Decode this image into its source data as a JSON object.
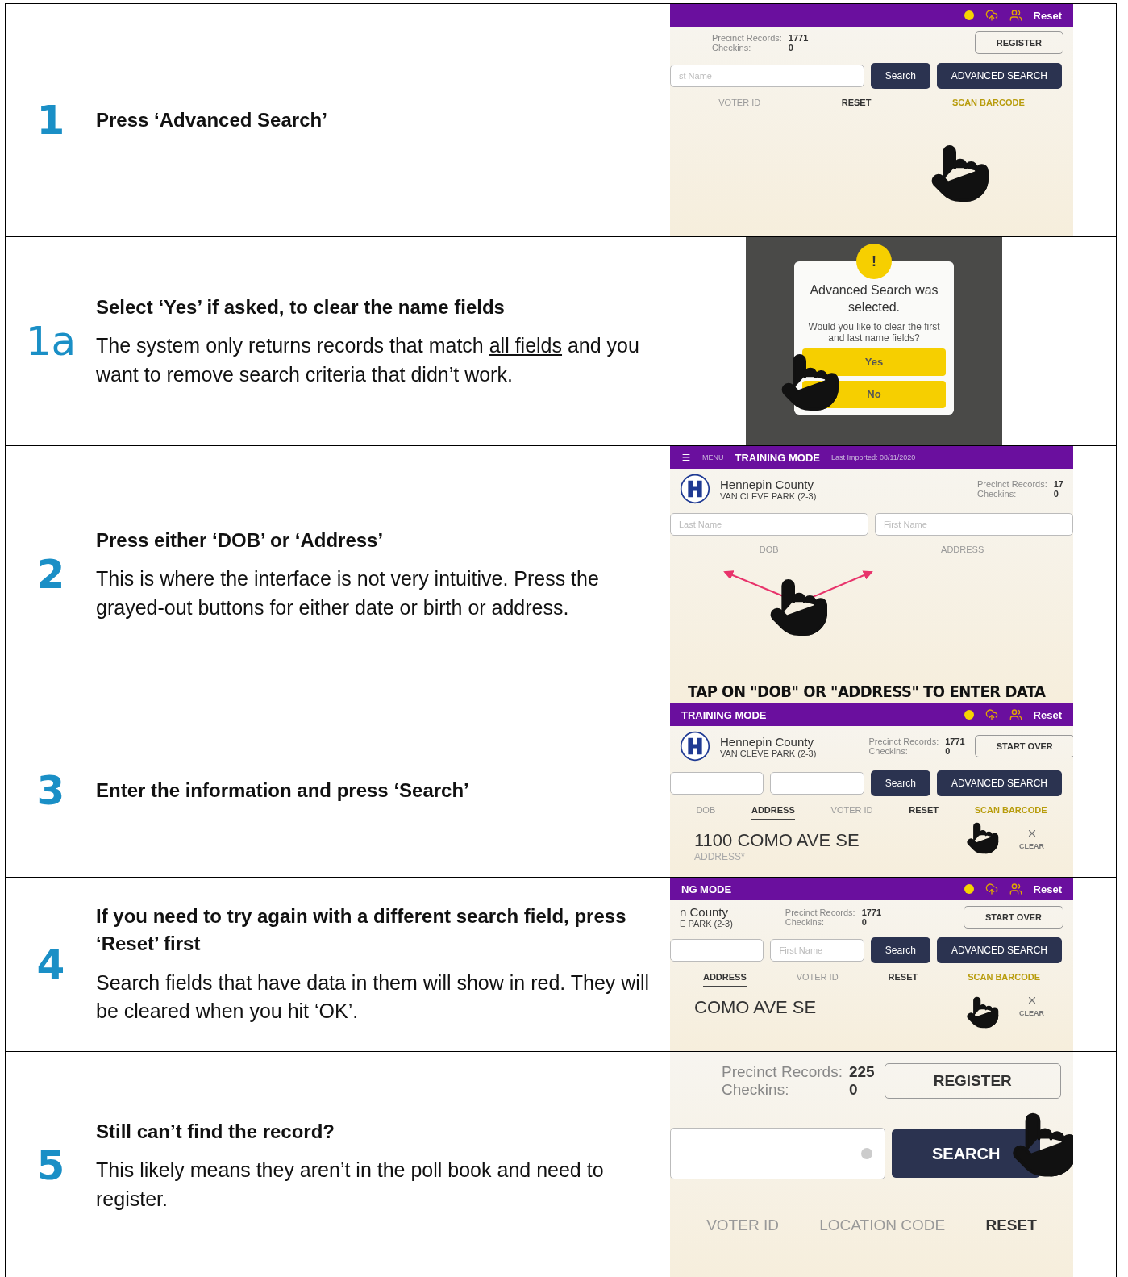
{
  "steps": [
    {
      "number": "1",
      "bold_number": true,
      "heading": "Press ‘Advanced Search’",
      "screen": {
        "kind": "app",
        "hand": true,
        "topbar": {
          "alert": true,
          "reset": "Reset"
        },
        "header": {
          "records_label": "Precinct Records:",
          "records": "1771",
          "checkins_label": "Checkins:",
          "checkins": "0",
          "button": "REGISTER"
        },
        "inputs": [
          {
            "kind": "name",
            "placeholder": "st Name"
          }
        ],
        "actions": [
          "Search",
          "ADVANCED SEARCH"
        ],
        "tabs": [
          {
            "label": "VOTER ID",
            "kind": "plain",
            "selected": false
          },
          {
            "label": "RESET",
            "kind": "strong",
            "selected": false
          },
          {
            "label": "SCAN BARCODE",
            "kind": "accent",
            "selected": false
          }
        ]
      }
    },
    {
      "number": "1a",
      "bold_number": false,
      "heading": "Select ‘Yes’ if asked, to clear the name fields",
      "body": {
        "before": "The system only returns records that match ",
        "underlined": "all fields",
        "after": " and you want to remove search criteria that didn’t work."
      },
      "screen": {
        "kind": "dialog",
        "hand": true,
        "dialog": {
          "icon_text": "!",
          "title": "Advanced Search was selected.",
          "message": "Would you like to clear the first and last name fields?",
          "buttons": [
            "Yes",
            "No"
          ]
        }
      }
    },
    {
      "number": "2",
      "bold_number": true,
      "heading": "Press either ‘DOB’ or ‘Address’",
      "body": {
        "before": "This is where the interface is not very intuitive. Press the grayed-out buttons for either date or birth or address."
      },
      "screen": {
        "kind": "app",
        "hand": true,
        "arrows": true,
        "topbar": {
          "menu": "MENU",
          "mode": "TRAINING MODE",
          "imported": "Last Imported: 08/11/2020"
        },
        "header": {
          "logo": true,
          "county": "Hennepin County",
          "precinct": "VAN CLEVE PARK (2-3)",
          "records_label": "Precinct Records:",
          "records": "17",
          "checkins_label": "Checkins:",
          "checkins": "0"
        },
        "inputs": [
          {
            "kind": "name",
            "placeholder": "Last Name"
          },
          {
            "kind": "name",
            "placeholder": "First Name"
          }
        ],
        "tabs": [
          {
            "label": "DOB",
            "kind": "plain",
            "selected": false
          },
          {
            "label": "ADDRESS",
            "kind": "plain",
            "selected": false
          }
        ],
        "caption": "TAP ON \"DOB\" OR \"ADDRESS\" TO ENTER DATA"
      }
    },
    {
      "number": "3",
      "bold_number": true,
      "heading": "Enter the information and press ‘Search’",
      "screen": {
        "kind": "app",
        "hand": true,
        "topbar": {
          "mode": "TRAINING MODE",
          "alert": true,
          "reset": "Reset"
        },
        "header": {
          "logo": true,
          "county": "Hennepin County",
          "precinct": "VAN CLEVE PARK (2-3)",
          "records_label": "Precinct Records:",
          "records": "1771",
          "checkins_label": "Checkins:",
          "checkins": "0",
          "button": "START OVER"
        },
        "inputs": [
          {
            "kind": "name"
          },
          {
            "kind": "name"
          }
        ],
        "actions": [
          "Search",
          "ADVANCED SEARCH"
        ],
        "tabs": [
          {
            "label": "DOB",
            "kind": "plain",
            "selected": false
          },
          {
            "label": "ADDRESS",
            "kind": "strong",
            "selected": true
          },
          {
            "label": "VOTER ID",
            "kind": "plain",
            "selected": false
          },
          {
            "label": "RESET",
            "kind": "strong",
            "selected": false
          },
          {
            "label": "SCAN BARCODE",
            "kind": "accent",
            "selected": false
          }
        ],
        "clear": "CLEAR",
        "value": "1100 COMO AVE SE",
        "value_label": "ADDRESS*"
      }
    },
    {
      "number": "4",
      "bold_number": true,
      "heading": "If you need to try again with a different search field, press ‘Reset’ first",
      "body": {
        "before": "Search fields that have data in them will show in red. They will be cleared when you hit ‘OK’."
      },
      "screen": {
        "kind": "app",
        "hand": true,
        "topbar": {
          "mode": "NG MODE",
          "alert": true,
          "reset": "Reset"
        },
        "header": {
          "county": "n County",
          "precinct": "E PARK (2-3)",
          "records_label": "Precinct Records:",
          "records": "1771",
          "checkins_label": "Checkins:",
          "checkins": "0",
          "button": "START OVER"
        },
        "inputs": [
          {
            "kind": "name"
          },
          {
            "kind": "name",
            "placeholder": "First Name"
          }
        ],
        "actions": [
          "Search",
          "ADVANCED SEARCH"
        ],
        "tabs": [
          {
            "label": "ADDRESS",
            "kind": "strong",
            "selected": true
          },
          {
            "label": "VOTER ID",
            "kind": "plain",
            "selected": false
          },
          {
            "label": "RESET",
            "kind": "strong",
            "selected": false
          },
          {
            "label": "SCAN BARCODE",
            "kind": "accent",
            "selected": false
          }
        ],
        "clear": "CLEAR",
        "value": "COMO AVE SE"
      }
    },
    {
      "number": "5",
      "bold_number": true,
      "heading": "Still can’t find the record?",
      "body": {
        "before": "This likely means they aren’t in the poll book and need to register."
      },
      "screen": {
        "kind": "app_large",
        "hand": true,
        "header": {
          "records_label": "Precinct Records:",
          "records": "225",
          "checkins_label": "Checkins:",
          "checkins": "0",
          "button": "REGISTER"
        },
        "inputs": [
          {
            "kind": "search"
          }
        ],
        "actions": [
          "SEARCH"
        ],
        "tabs": [
          {
            "label": "VOTER ID",
            "kind": "plain",
            "selected": false
          },
          {
            "label": "LOCATION CODE",
            "kind": "plain",
            "selected": false
          },
          {
            "label": "RESET",
            "kind": "strong",
            "selected": false
          }
        ]
      }
    }
  ]
}
